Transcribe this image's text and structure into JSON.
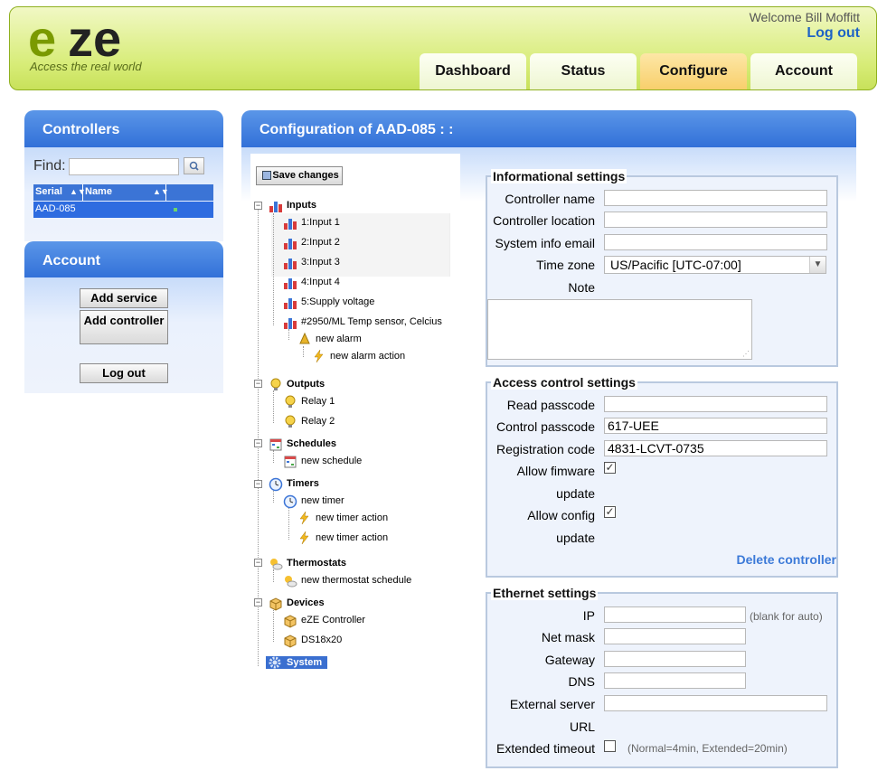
{
  "header": {
    "logo_text": "eze",
    "tagline": "Access the real world",
    "welcome": "Welcome Bill Moffitt",
    "logout": "Log out",
    "tabs": [
      {
        "label": "Dashboard"
      },
      {
        "label": "Status"
      },
      {
        "label": "Configure",
        "active": true
      },
      {
        "label": "Account"
      }
    ]
  },
  "controllers_panel": {
    "title": "Controllers",
    "find_label": "Find:",
    "find_value": "",
    "columns": [
      "Serial",
      "Name",
      ""
    ],
    "rows": [
      {
        "serial": "AAD-085",
        "name": ""
      }
    ]
  },
  "account_panel": {
    "title": "Account",
    "add_service": "Add service",
    "add_controller": "Add controller",
    "log_out": "Log out"
  },
  "config": {
    "title": "Configuration of AAD-085 : :",
    "save_changes": "Save changes",
    "tree": {
      "inputs": "Inputs",
      "input1": "1:Input 1",
      "input2": "2:Input 2",
      "input3": "3:Input 3",
      "input4": "4:Input 4",
      "input5": "5:Supply voltage",
      "input6": "#2950/ML Temp sensor, Celcius",
      "alarm": "new alarm",
      "alarm_action": "new alarm action",
      "outputs": "Outputs",
      "relay1": "Relay 1",
      "relay2": "Relay 2",
      "schedules": "Schedules",
      "new_schedule": "new schedule",
      "timers": "Timers",
      "new_timer": "new timer",
      "timer_action1": "new timer action",
      "timer_action2": "new timer action",
      "thermostats": "Thermostats",
      "thermostat_schedule": "new thermostat schedule",
      "devices": "Devices",
      "eze_controller": "eZE Controller",
      "ds18x20": "DS18x20",
      "system": "System"
    },
    "informational": {
      "legend": "Informational settings",
      "controller_name_label": "Controller name",
      "controller_name": "",
      "controller_location_label": "Controller location",
      "controller_location": "",
      "system_email_label": "System info email",
      "system_email": "",
      "timezone_label": "Time zone",
      "timezone": "US/Pacific [UTC-07:00]",
      "note_label": "Note",
      "note": ""
    },
    "access": {
      "legend": "Access control settings",
      "read_passcode_label": "Read passcode",
      "read_passcode": "",
      "control_passcode_label": "Control passcode",
      "control_passcode": "617-UEE",
      "registration_code_label": "Registration code",
      "registration_code": "4831-LCVT-0735",
      "allow_firmware_label1": "Allow fimware",
      "allow_firmware_label2": "update",
      "allow_firmware_checked": true,
      "allow_config_label1": "Allow config",
      "allow_config_label2": "update",
      "allow_config_checked": true,
      "delete_controller": "Delete controller"
    },
    "ethernet": {
      "legend": "Ethernet settings",
      "ip_label": "IP",
      "ip": "",
      "ip_hint": "(blank for auto)",
      "netmask_label": "Net mask",
      "netmask": "",
      "gateway_label": "Gateway",
      "gateway": "",
      "dns_label": "DNS",
      "dns": "",
      "external_server_label1": "External server",
      "external_server_label2": "URL",
      "external_server": "",
      "extended_timeout_label": "Extended timeout",
      "extended_timeout_checked": false,
      "extended_timeout_hint": "(Normal=4min, Extended=20min)"
    }
  },
  "colors": {
    "header_green": "#d7ec77",
    "panel_blue": "#3270d8",
    "link_blue": "#1e63c5",
    "active_tab": "#f8cf6c"
  }
}
